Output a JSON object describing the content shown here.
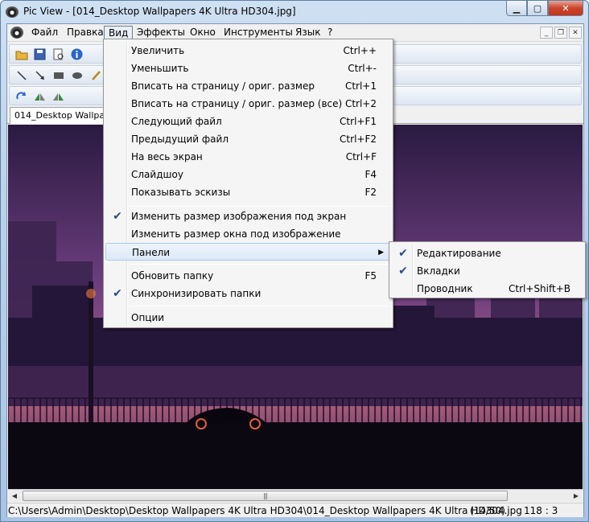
{
  "window": {
    "title": "Pic View - [014_Desktop Wallpapers 4K Ultra HD304.jpg]",
    "controls": {
      "minimize": "▁",
      "maximize": "▢",
      "close": "✕"
    }
  },
  "menubar": {
    "items": [
      "Файл",
      "Правка",
      "Вид",
      "Эффекты",
      "Окно",
      "Инструменты",
      "Язык",
      "?"
    ],
    "mdi_controls": {
      "minimize": "_",
      "restore": "❐",
      "close": "✕"
    }
  },
  "tab": {
    "label": "014_Desktop Wallpape"
  },
  "view_menu": {
    "items": [
      {
        "label": "Увеличить",
        "shortcut": "Ctrl++"
      },
      {
        "label": "Уменьшить",
        "shortcut": "Ctrl+-"
      },
      {
        "label": "Вписать на страницу / ориг. размер",
        "shortcut": "Ctrl+1"
      },
      {
        "label": "Вписать на страницу / ориг. размер (все)",
        "shortcut": "Ctrl+2"
      },
      {
        "label": "Следующий файл",
        "shortcut": "Ctrl+F1"
      },
      {
        "label": "Предыдущий файл",
        "shortcut": "Ctrl+F2"
      },
      {
        "label": "На весь экран",
        "shortcut": "Ctrl+F"
      },
      {
        "label": "Слайдшоу",
        "shortcut": "F4"
      },
      {
        "label": "Показывать эскизы",
        "shortcut": "F2"
      },
      {
        "label": "Изменить размер изображения под экран",
        "shortcut": "",
        "checked": true
      },
      {
        "label": "Изменить размер окна под изображение",
        "shortcut": ""
      },
      {
        "label": "Панели",
        "shortcut": "",
        "submenu": true
      },
      {
        "label": "Обновить папку",
        "shortcut": "F5"
      },
      {
        "label": "Синхронизировать папки",
        "shortcut": "",
        "checked": true
      },
      {
        "label": "Опции",
        "shortcut": ""
      }
    ],
    "check_glyph": "✔",
    "submenu_arrow": "▶"
  },
  "panels_submenu": {
    "items": [
      {
        "label": "Редактирование",
        "shortcut": "",
        "checked": true
      },
      {
        "label": "Вкладки",
        "shortcut": "",
        "checked": true
      },
      {
        "label": "Проводник",
        "shortcut": "Ctrl+Shift+B"
      }
    ]
  },
  "scrollbar": {
    "left_arrow": "◀",
    "right_arrow": "▶",
    "grip": "|||"
  },
  "statusbar": {
    "path": "C:\\Users\\Admin\\Desktop\\Desktop Wallpapers 4K Ultra HD304\\014_Desktop Wallpapers 4K Ultra HD304.jpg",
    "position": "(14/50)",
    "ratio": "118 : 3"
  },
  "toolbar_icons": [
    "open-folder-icon",
    "save-icon",
    "print-preview-icon",
    "info-icon",
    "line-tool-icon",
    "arrow-tool-icon",
    "rectangle-tool-icon",
    "ellipse-tool-icon",
    "pencil-tool-icon",
    "rotate-icon",
    "flip-icon",
    "mirror-icon"
  ]
}
